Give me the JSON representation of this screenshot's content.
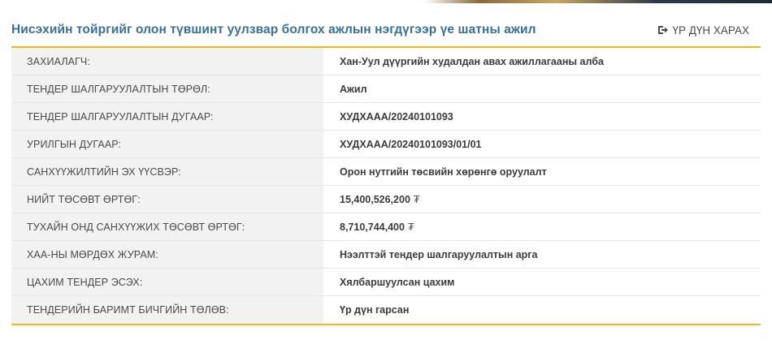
{
  "header": {
    "title": "Нисэхийн тойргийг олон түвшинт уулзвар болгох ажлын нэгдүгээр үе шатны ажил",
    "view_result_label": "ҮР ДҮН ХАРАХ",
    "view_result_icon": "sign-in-icon"
  },
  "colors": {
    "accent": "#f2b51e",
    "title": "#3a6f98",
    "label_bg": "#f2f2f2"
  },
  "rows": [
    {
      "label": "ЗАХИАЛАГЧ:",
      "value": "Хан-Уул дүүргийн худалдан авах ажиллагааны алба",
      "currency": ""
    },
    {
      "label": "ТЕНДЕР ШАЛГАРУУЛАЛТЫН ТӨРӨЛ:",
      "value": "Ажил",
      "currency": ""
    },
    {
      "label": "ТЕНДЕР ШАЛГАРУУЛАЛТЫН ДУГААР:",
      "value": "ХУДХААА/20240101093",
      "currency": ""
    },
    {
      "label": "УРИЛГЫН ДУГААР:",
      "value": "ХУДХААА/20240101093/01/01",
      "currency": ""
    },
    {
      "label": "САНХҮҮЖИЛТИЙН ЭХ ҮҮСВЭР:",
      "value": "Орон нутгийн төсвийн хөрөнгө оруулалт",
      "currency": ""
    },
    {
      "label": "НИЙТ ТӨСӨВТ ӨРТӨГ:",
      "value": "15,400,526,200",
      "currency": "₮"
    },
    {
      "label": "ТУХАЙН ОНД САНХҮҮЖИХ ТӨСӨВТ ӨРТӨГ:",
      "value": "8,710,744,400",
      "currency": "₮"
    },
    {
      "label": "ХАА-НЫ МӨРДӨХ ЖУРАМ:",
      "value": "Нээлттэй тендер шалгаруулалтын арга",
      "currency": ""
    },
    {
      "label": "ЦАХИМ ТЕНДЕР ЭСЭХ:",
      "value": "Хялбаршуулсан цахим",
      "currency": ""
    },
    {
      "label": "ТЕНДЕРИЙН БАРИМТ БИЧГИЙН ТӨЛӨВ:",
      "value": "Үр дүн гарсан",
      "currency": ""
    }
  ]
}
